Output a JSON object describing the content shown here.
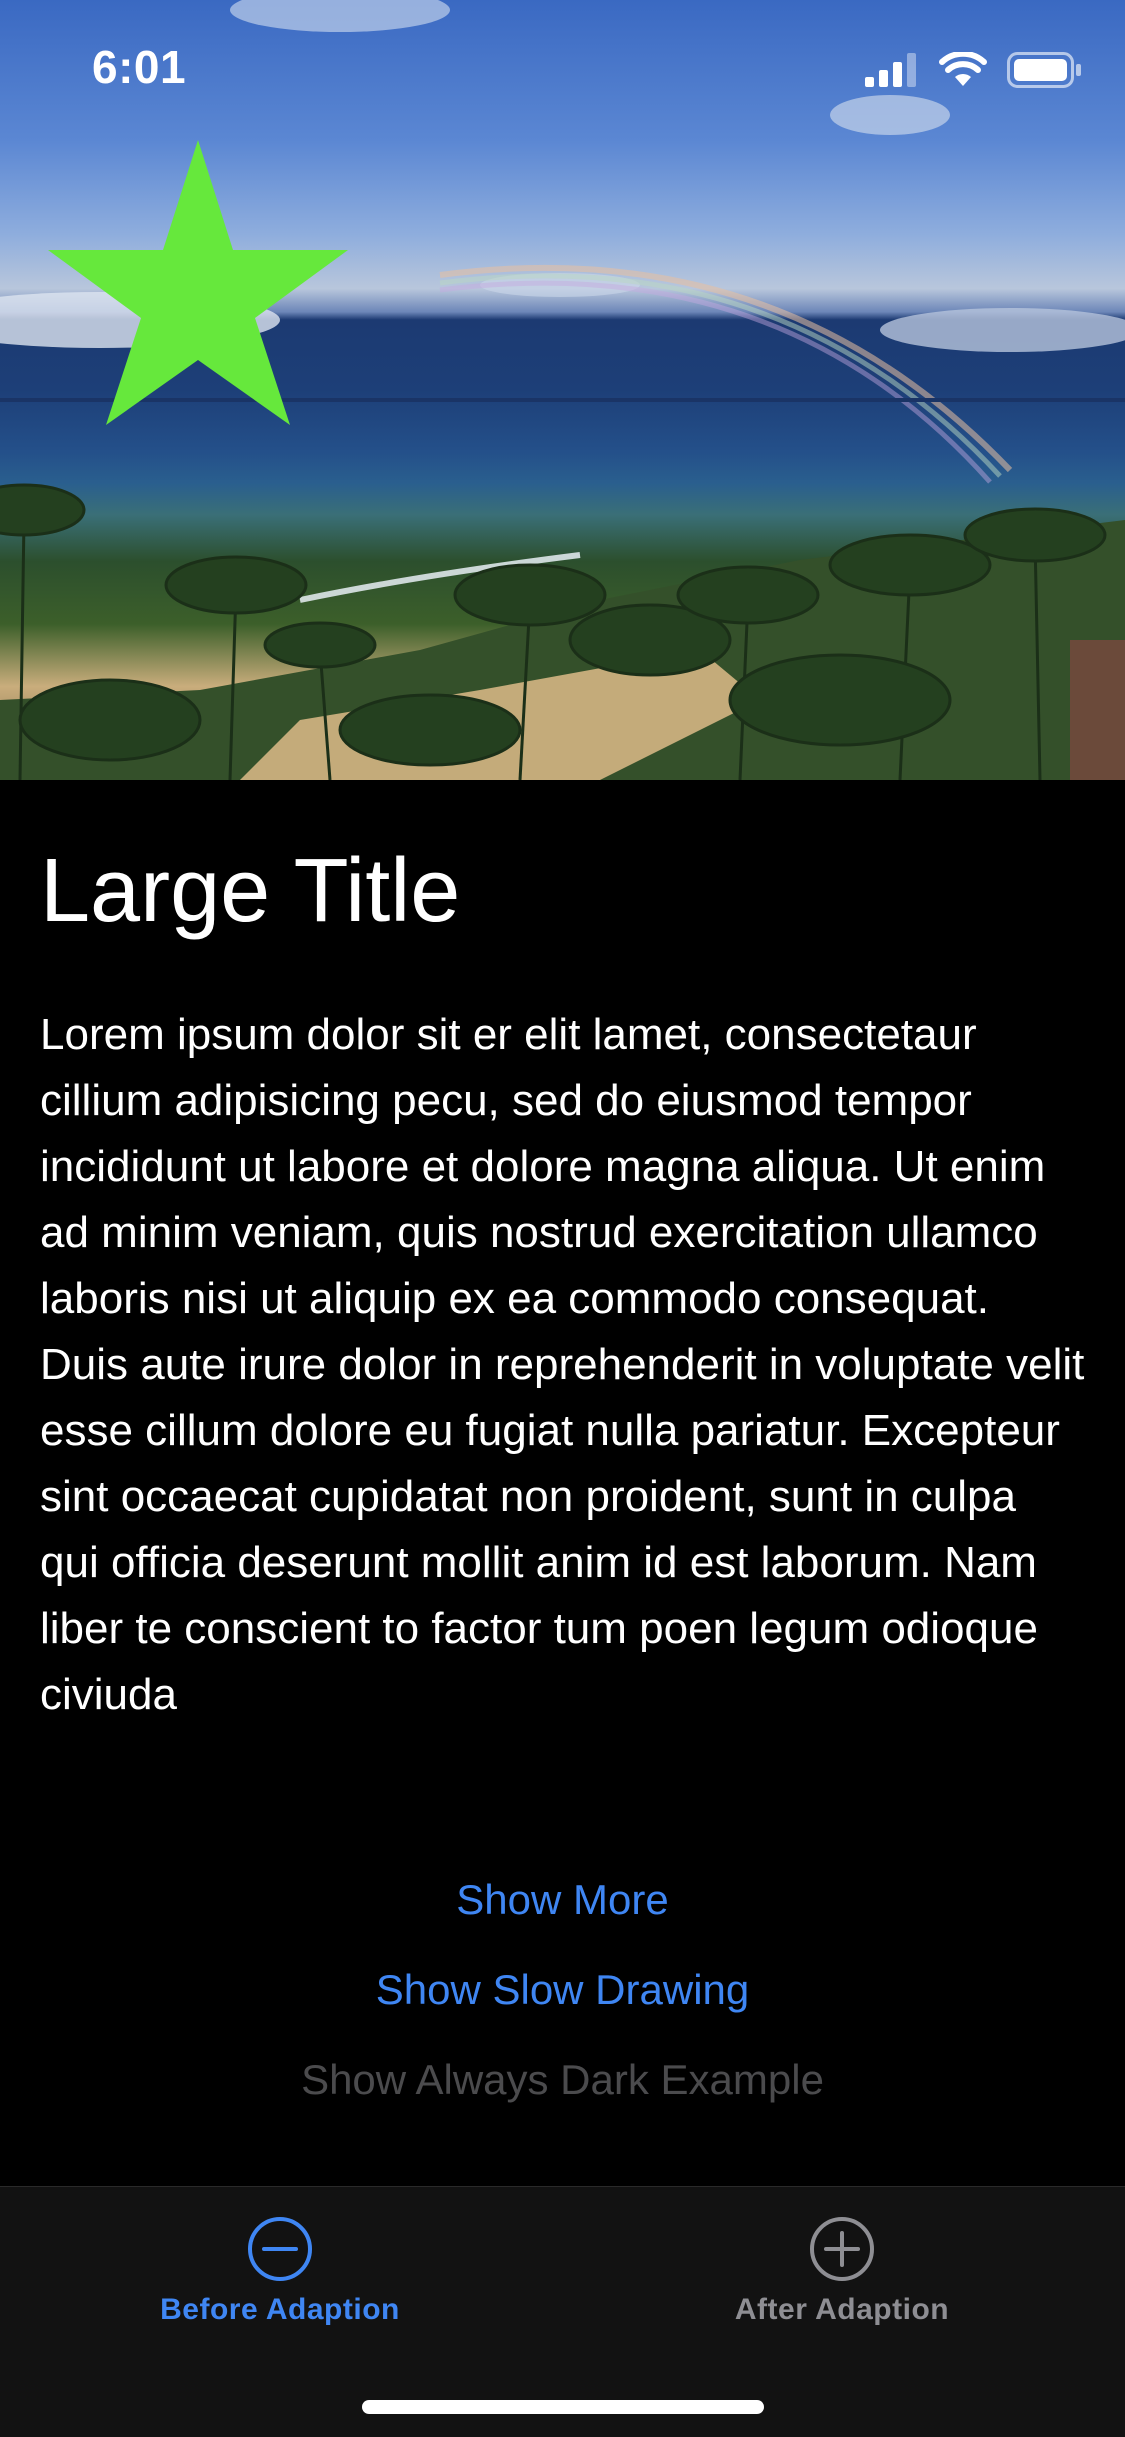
{
  "status_bar": {
    "time": "6:01",
    "signal_icon": "cellular-signal-icon",
    "wifi_icon": "wifi-icon",
    "battery_icon": "battery-icon"
  },
  "hero": {
    "image": "tropical-beach-rainbow-photo",
    "overlay_icon": "star-icon",
    "star_color": "#66e83c"
  },
  "main": {
    "title": "Large Title",
    "body": "Lorem ipsum dolor sit er elit lamet, consectetaur cillium adipisicing pecu, sed do eiusmod tempor incididunt ut labore et dolore magna aliqua. Ut enim ad minim veniam, quis nostrud exercitation ullamco laboris nisi ut aliquip ex ea commodo consequat. Duis aute irure dolor in reprehenderit in voluptate velit esse cillum dolore eu fugiat nulla pariatur. Excepteur sint occaecat cupidatat non proident, sunt in culpa qui officia deserunt mollit anim id est laborum. Nam liber te conscient to factor tum poen legum odioque civiuda"
  },
  "actions": {
    "show_more": "Show More",
    "show_slow_drawing": "Show Slow Drawing",
    "show_always_dark": "Show Always Dark Example"
  },
  "tab_bar": {
    "tabs": [
      {
        "label": "Before Adaption",
        "icon": "minus-circle-icon",
        "selected": true
      },
      {
        "label": "After Adaption",
        "icon": "plus-circle-icon",
        "selected": false
      }
    ]
  },
  "colors": {
    "accent": "#3f86f3",
    "background": "#000000",
    "tab_bar_background": "#121212",
    "inactive": "#8e8e93",
    "disabled": "#4b4b4d"
  }
}
